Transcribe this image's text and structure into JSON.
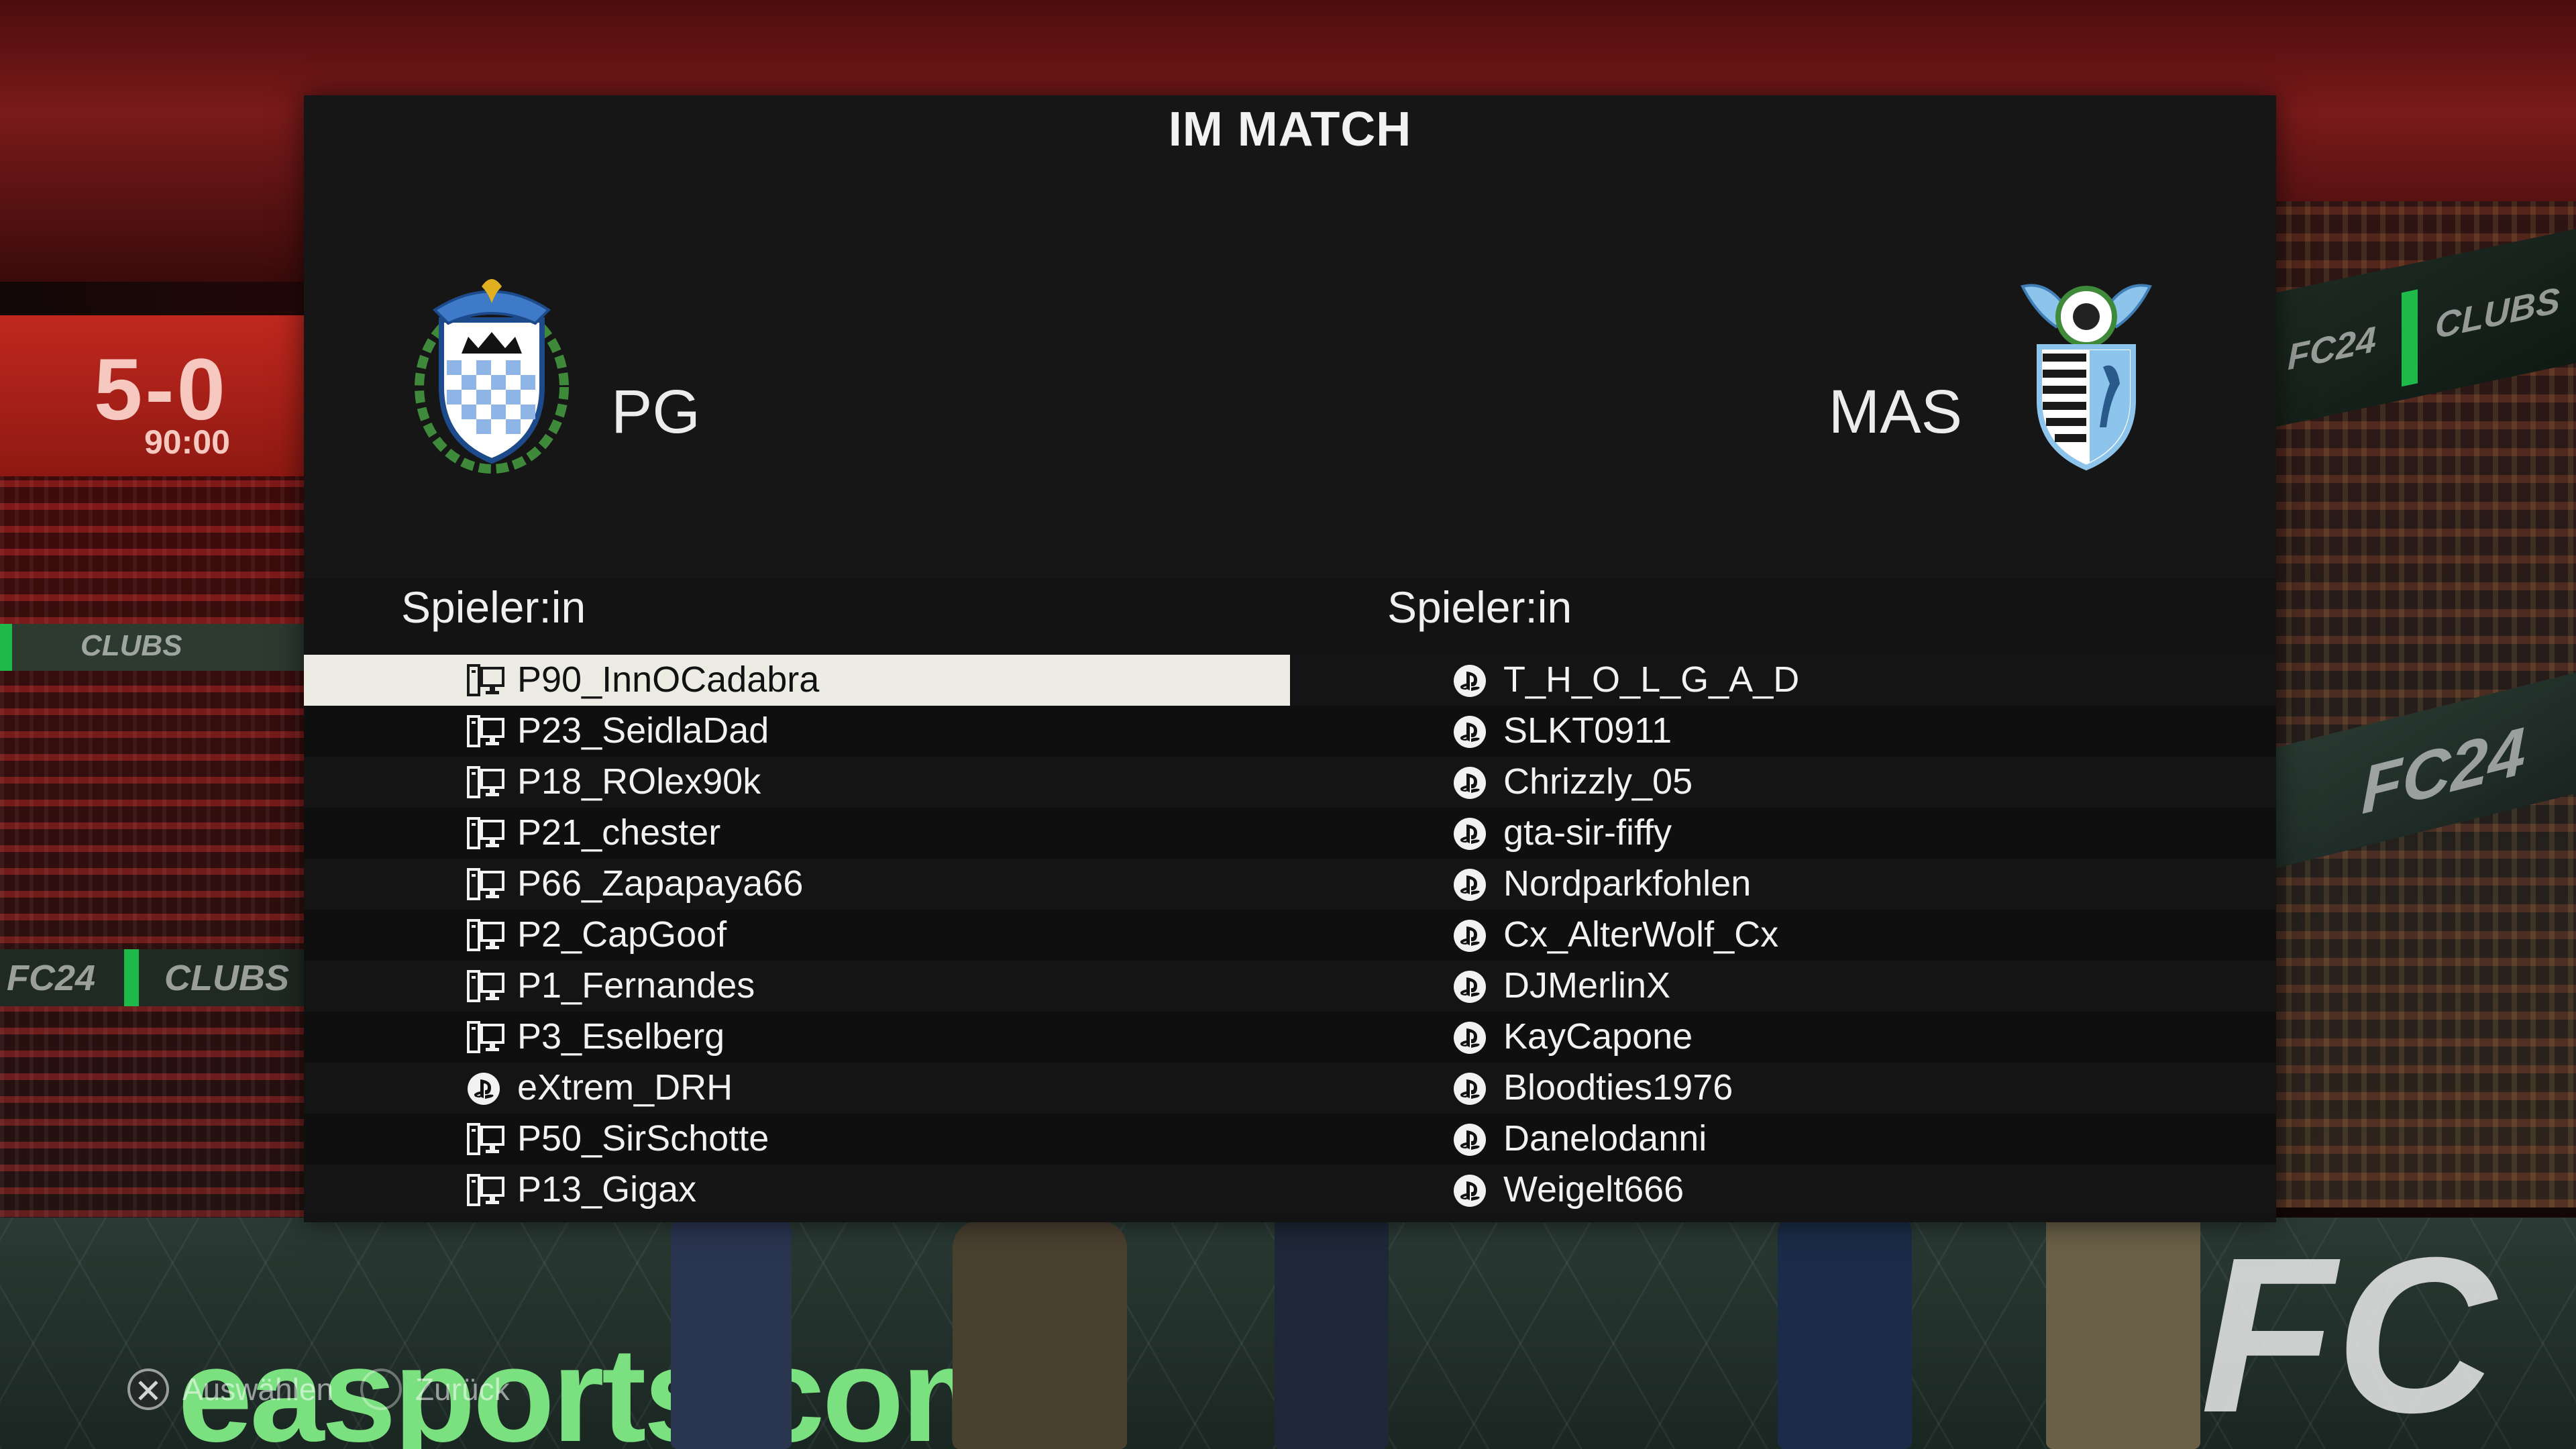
{
  "screen": {
    "title": "IM MATCH"
  },
  "background": {
    "score": "5-0",
    "clock": "90:00",
    "ad_clubs": "CLUBS",
    "ad_fc24": "FC24",
    "ad_easports": "easports.com/"
  },
  "home": {
    "abbr": "PG",
    "crest_icon": "club-crest-blue-checkered-shield",
    "column_header": "Spieler:in",
    "players": [
      {
        "name": "P90_InnOCadabra",
        "platform": "pc-icon",
        "selected": true
      },
      {
        "name": "P23_SeidlaDad",
        "platform": "pc-icon"
      },
      {
        "name": "P18_ROlex90k",
        "platform": "pc-icon"
      },
      {
        "name": "P21_chester",
        "platform": "pc-icon"
      },
      {
        "name": "P66_Zapapaya66",
        "platform": "pc-icon"
      },
      {
        "name": "P2_CapGoof",
        "platform": "pc-icon"
      },
      {
        "name": "P1_Fernandes",
        "platform": "pc-icon"
      },
      {
        "name": "P3_Eselberg",
        "platform": "pc-icon"
      },
      {
        "name": "eXtrem_DRH",
        "platform": "playstation-icon"
      },
      {
        "name": "P50_SirSchotte",
        "platform": "pc-icon"
      },
      {
        "name": "P13_Gigax",
        "platform": "pc-icon"
      }
    ]
  },
  "away": {
    "abbr": "MAS",
    "crest_icon": "club-crest-winged-striped-shield",
    "column_header": "Spieler:in",
    "players": [
      {
        "name": "T_H_O_L_G_A_D",
        "platform": "playstation-icon"
      },
      {
        "name": "SLKT0911",
        "platform": "playstation-icon"
      },
      {
        "name": "Chrizzly_05",
        "platform": "playstation-icon"
      },
      {
        "name": "gta-sir-fiffy",
        "platform": "playstation-icon"
      },
      {
        "name": "Nordparkfohlen",
        "platform": "playstation-icon"
      },
      {
        "name": "Cx_AlterWolf_Cx",
        "platform": "playstation-icon"
      },
      {
        "name": "DJMerlinX",
        "platform": "playstation-icon"
      },
      {
        "name": "KayCapone",
        "platform": "playstation-icon"
      },
      {
        "name": "Bloodties1976",
        "platform": "playstation-icon"
      },
      {
        "name": "Danelodanni",
        "platform": "playstation-icon"
      },
      {
        "name": "Weigelt666",
        "platform": "playstation-icon"
      }
    ]
  },
  "footer": {
    "select_hint": "Auswählen",
    "back_hint": "Zurück"
  },
  "colors": {
    "panel_bg": "#131313",
    "selected_row": "#ecebe4",
    "text": "#f2f2f2"
  }
}
